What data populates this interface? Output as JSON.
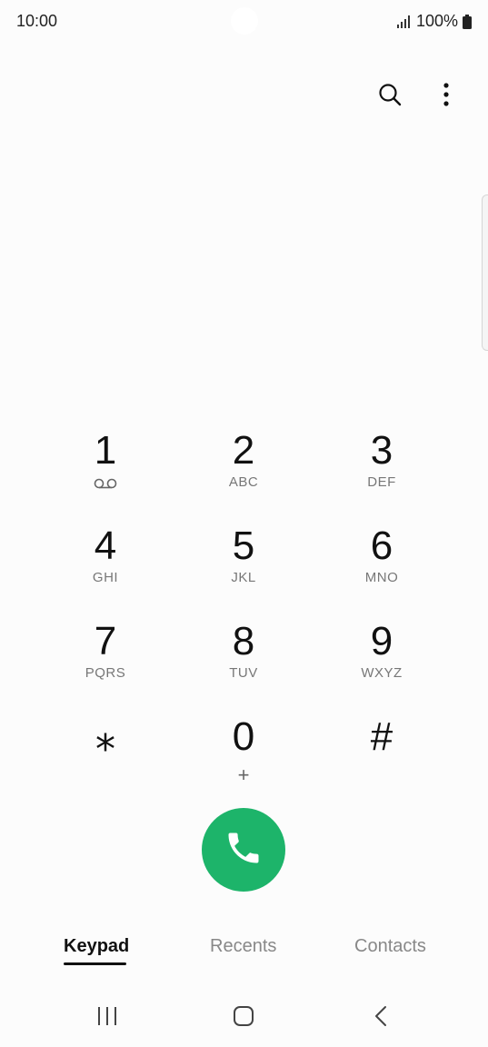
{
  "status_bar": {
    "time": "10:00",
    "battery": "100%"
  },
  "keypad": [
    {
      "digit": "1",
      "letters": "",
      "icon": "voicemail-icon"
    },
    {
      "digit": "2",
      "letters": "ABC"
    },
    {
      "digit": "3",
      "letters": "DEF"
    },
    {
      "digit": "4",
      "letters": "GHI"
    },
    {
      "digit": "5",
      "letters": "JKL"
    },
    {
      "digit": "6",
      "letters": "MNO"
    },
    {
      "digit": "7",
      "letters": "PQRS"
    },
    {
      "digit": "8",
      "letters": "TUV"
    },
    {
      "digit": "9",
      "letters": "WXYZ"
    },
    {
      "digit": "⁎",
      "letters": ""
    },
    {
      "digit": "0",
      "sub": "+"
    },
    {
      "digit": "#",
      "letters": ""
    }
  ],
  "tabs": [
    {
      "label": "Keypad",
      "active": true
    },
    {
      "label": "Recents",
      "active": false
    },
    {
      "label": "Contacts",
      "active": false
    }
  ],
  "icons": {
    "search": "search-icon",
    "more": "more-vertical-icon",
    "call": "phone-icon",
    "nav_recents": "recent-apps-icon",
    "nav_home": "home-icon",
    "nav_back": "back-icon"
  },
  "colors": {
    "call_button": "#1db46a"
  }
}
